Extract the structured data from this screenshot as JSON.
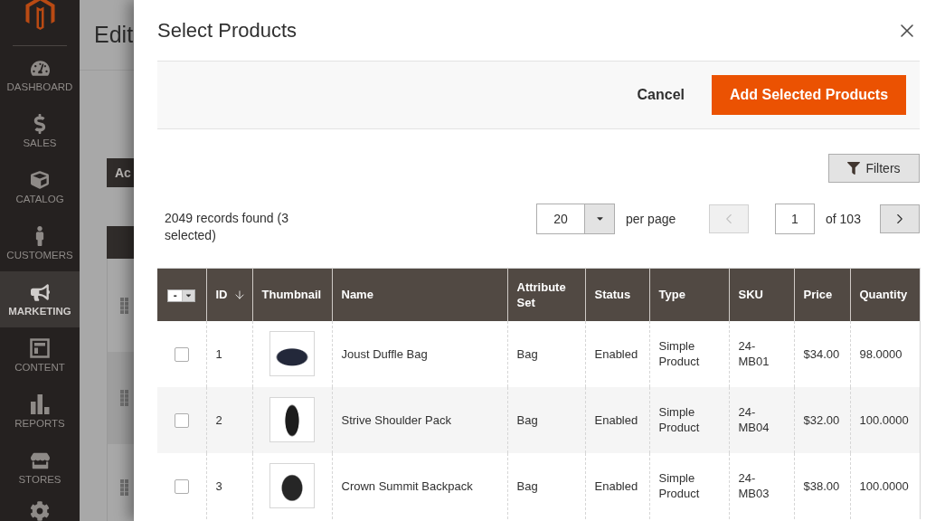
{
  "sidebar": {
    "items": [
      {
        "label": "DASHBOARD",
        "selected": false
      },
      {
        "label": "SALES",
        "selected": false
      },
      {
        "label": "CATALOG",
        "selected": false
      },
      {
        "label": "CUSTOMERS",
        "selected": false
      },
      {
        "label": "MARKETING",
        "selected": true
      },
      {
        "label": "CONTENT",
        "selected": false
      },
      {
        "label": "REPORTS",
        "selected": false
      },
      {
        "label": "STORES",
        "selected": false
      }
    ]
  },
  "background_page": {
    "title": "Edit",
    "button": "Ac"
  },
  "modal": {
    "title": "Select Products",
    "actions": [
      {
        "kind": "secondary",
        "label": "Cancel"
      },
      {
        "kind": "primary",
        "label": "Add Selected Products"
      }
    ],
    "filters_button": "Filters",
    "records_found": "2049 records found (3 selected)",
    "per_page": {
      "value": "20",
      "label": "per page"
    },
    "pager": {
      "previous": {
        "disabled": true
      },
      "page": "1",
      "total": "of 103",
      "next": {
        "disabled": false
      }
    },
    "table": {
      "mass_select": {
        "mark": "-"
      },
      "columns": [
        {
          "label": "ID",
          "sorted": true
        },
        {
          "label": "Thumbnail",
          "sorted": false
        },
        {
          "label": "Name",
          "sorted": false
        },
        {
          "label": "Attribute Set",
          "sorted": false
        },
        {
          "label": "Status",
          "sorted": false
        },
        {
          "label": "Type",
          "sorted": false
        },
        {
          "label": "SKU",
          "sorted": false
        },
        {
          "label": "Price",
          "sorted": false
        },
        {
          "label": "Quantity",
          "sorted": false
        }
      ],
      "rows": [
        {
          "checked": false,
          "id": "1",
          "name": "Joust Duffle Bag",
          "attribute_set": "Bag",
          "status": "Enabled",
          "type": "Simple Product",
          "sku": "24-MB01",
          "price": "$34.00",
          "quantity": "98.0000"
        },
        {
          "checked": false,
          "id": "2",
          "name": "Strive Shoulder Pack",
          "attribute_set": "Bag",
          "status": "Enabled",
          "type": "Simple Product",
          "sku": "24-MB04",
          "price": "$32.00",
          "quantity": "100.0000"
        },
        {
          "checked": false,
          "id": "3",
          "name": "Crown Summit Backpack",
          "attribute_set": "Bag",
          "status": "Enabled",
          "type": "Simple Product",
          "sku": "24-MB03",
          "price": "$38.00",
          "quantity": "100.0000"
        }
      ]
    }
  }
}
